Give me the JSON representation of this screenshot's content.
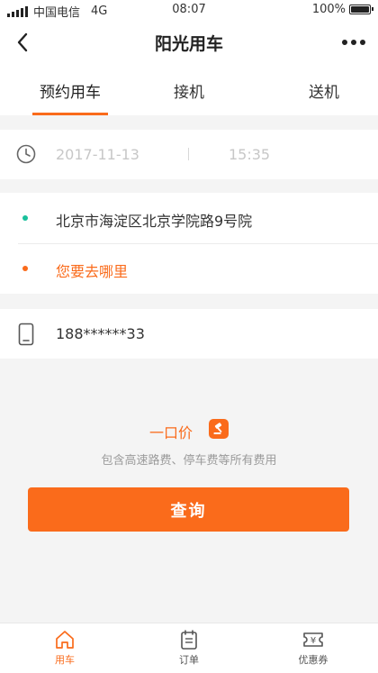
{
  "statusbar": {
    "carrier": "中国电信",
    "network": "4G",
    "time": "08:07",
    "battery": "100%",
    "battery_level": 1.0
  },
  "navbar": {
    "title": "阳光用车"
  },
  "tabs": [
    {
      "label": "预约用车",
      "active": true
    },
    {
      "label": "接机",
      "active": false
    },
    {
      "label": "送机",
      "active": false
    }
  ],
  "booking": {
    "date": "2017-11-13",
    "time": "15:35",
    "pickup": "北京市海淀区北京学院路9号院",
    "destination_placeholder": "您要去哪里",
    "phone": "188******33"
  },
  "price": {
    "label": "一口价",
    "note": "包含高速路费、停车费等所有费用"
  },
  "query_button": "查询",
  "bottom_nav": [
    {
      "label": "用车",
      "icon": "home-icon",
      "active": true
    },
    {
      "label": "订单",
      "icon": "order-icon",
      "active": false
    },
    {
      "label": "优惠券",
      "icon": "coupon-icon",
      "active": false
    }
  ],
  "colors": {
    "accent": "#fa6b1b",
    "pickup_dot": "#19c09b",
    "destination_dot": "#fa6b1b"
  }
}
